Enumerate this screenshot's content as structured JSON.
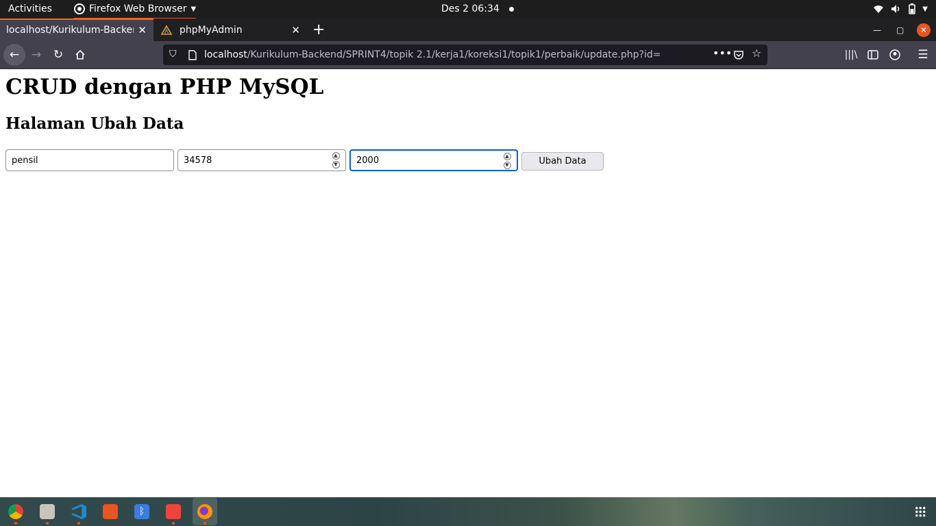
{
  "topbar": {
    "activities": "Activities",
    "app_name": "Firefox Web Browser",
    "clock": "Des 2  06:34"
  },
  "tabs": [
    {
      "title": "localhost/Kurikulum-Backen",
      "active": true
    },
    {
      "title": "phpMyAdmin",
      "active": false
    }
  ],
  "urlbar": {
    "host": "localhost",
    "path": "/Kurikulum-Backend/SPRINT4/topik 2.1/kerja1/koreksi1/topik1/perbaik/update.php?id="
  },
  "page": {
    "heading": "CRUD dengan PHP MySQL",
    "subheading": "Halaman Ubah Data",
    "form": {
      "name_value": "pensil",
      "code_value": "34578",
      "price_value": "2000",
      "submit_label": "Ubah Data"
    }
  },
  "dock": {
    "apps": [
      "chrome-icon",
      "files-icon",
      "vscode-icon",
      "software-center-icon",
      "bluetooth-icon",
      "anydesk-icon",
      "firefox-icon"
    ]
  },
  "colors": {
    "accent": "#e95420",
    "focus": "#0060df",
    "tab_active": "#42414d"
  }
}
